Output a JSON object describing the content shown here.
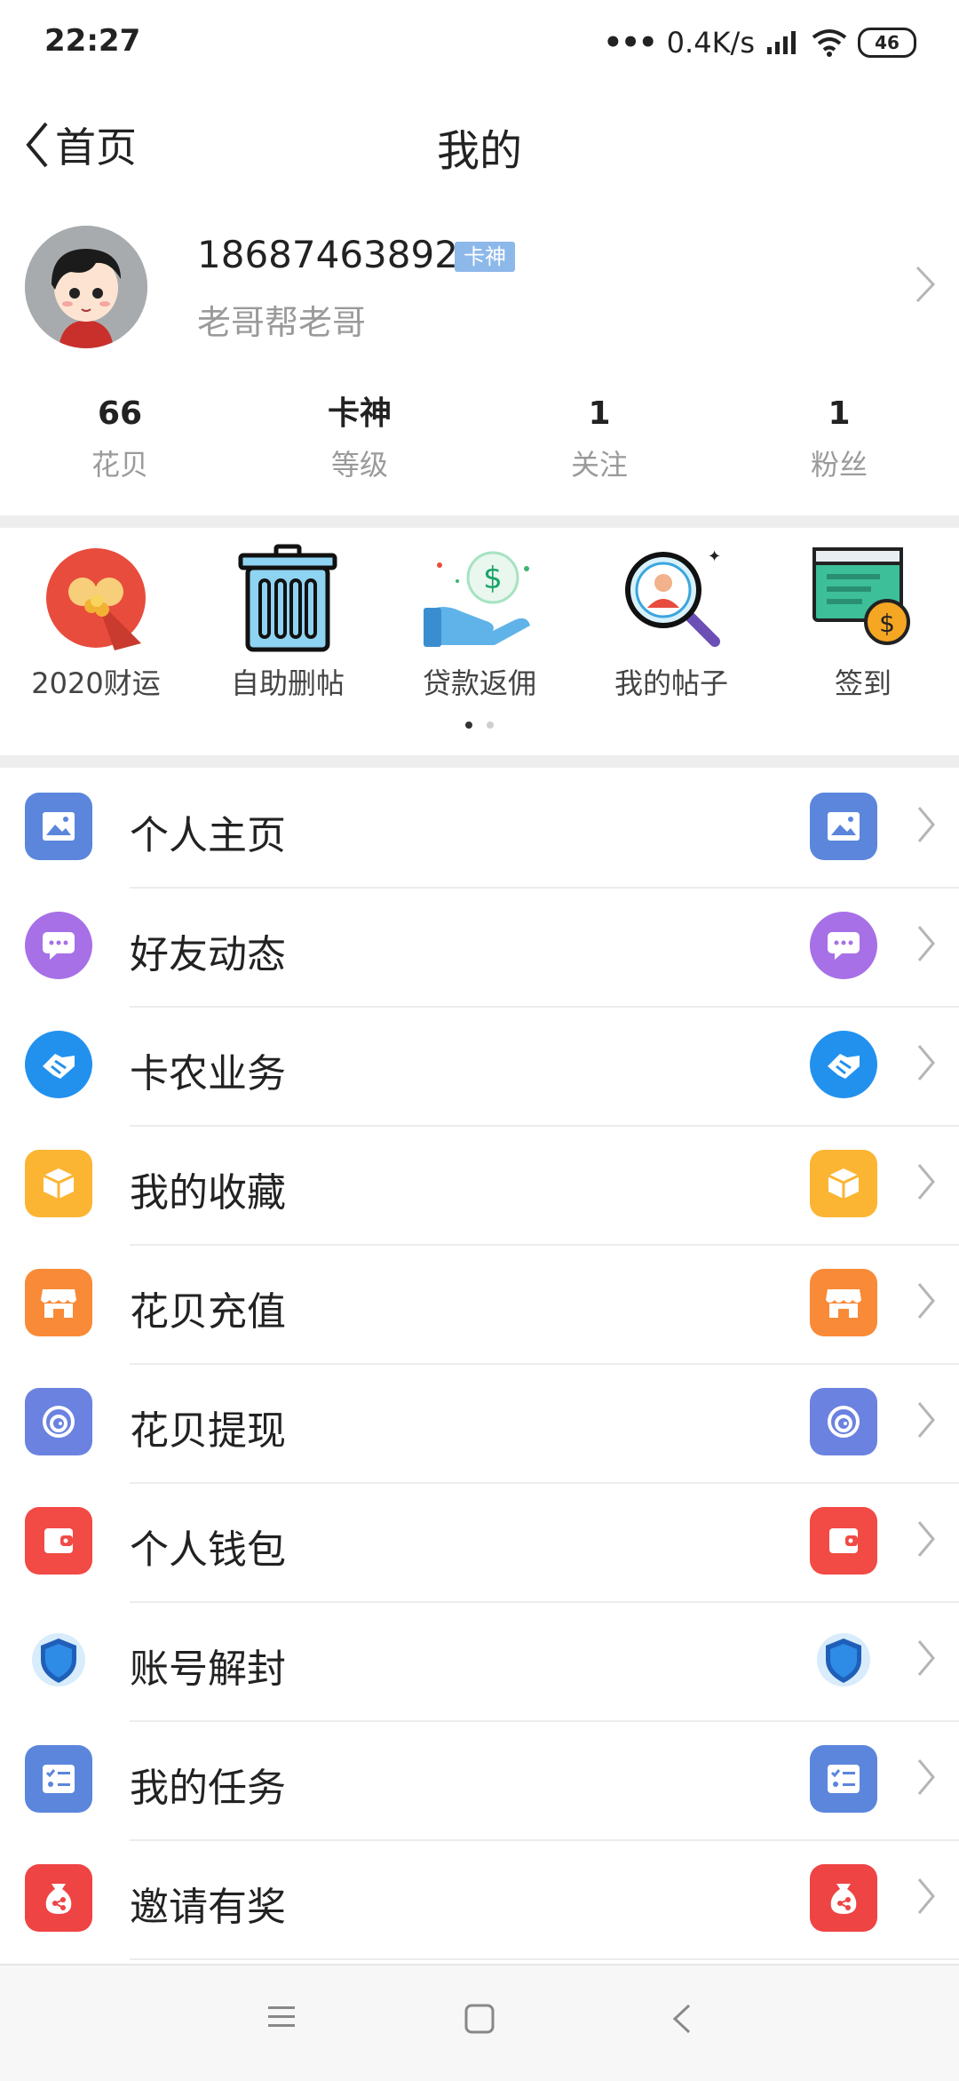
{
  "status_bar": {
    "time": "22:27",
    "network_speed": "0.4K/s",
    "battery": "46",
    "icons": [
      "dots-icon",
      "signal-icon",
      "wifi-icon",
      "battery-icon"
    ]
  },
  "nav": {
    "back_label": "首页",
    "title": "我的"
  },
  "profile": {
    "phone": "18687463892",
    "level_badge": "卡神",
    "nickname": "老哥帮老哥"
  },
  "stats": [
    {
      "value": "66",
      "label": "花贝"
    },
    {
      "value": "卡神",
      "label": "等级"
    },
    {
      "value": "1",
      "label": "关注"
    },
    {
      "value": "1",
      "label": "粉丝"
    }
  ],
  "tools": [
    {
      "label": "2020财运",
      "icon": "fortune-icon"
    },
    {
      "label": "自助删帖",
      "icon": "trash-icon"
    },
    {
      "label": "贷款返佣",
      "icon": "money-hand-icon"
    },
    {
      "label": "我的帖子",
      "icon": "search-user-icon"
    },
    {
      "label": "签到",
      "icon": "checkin-icon"
    }
  ],
  "pager": {
    "pages": 2,
    "active": 0
  },
  "menu": [
    {
      "label": "个人主页",
      "icon": "image-icon",
      "color": "#5b86dc"
    },
    {
      "label": "好友动态",
      "icon": "chat-icon",
      "color": "#a770e6"
    },
    {
      "label": "卡农业务",
      "icon": "handshake-icon",
      "color": "#2291ee"
    },
    {
      "label": "我的收藏",
      "icon": "box-icon",
      "color": "#fbb533"
    },
    {
      "label": "花贝充值",
      "icon": "shop-icon",
      "color": "#f98a37"
    },
    {
      "label": "花贝提现",
      "icon": "spiral-icon",
      "color": "#6b82e0"
    },
    {
      "label": "个人钱包",
      "icon": "wallet-icon",
      "color": "#f24a45"
    },
    {
      "label": "账号解封",
      "icon": "shield-icon",
      "color": "#1f5fb8"
    },
    {
      "label": "我的任务",
      "icon": "task-icon",
      "color": "#5b86dc"
    },
    {
      "label": "邀请有奖",
      "icon": "gift-bag-icon",
      "color": "#ef4444"
    }
  ]
}
